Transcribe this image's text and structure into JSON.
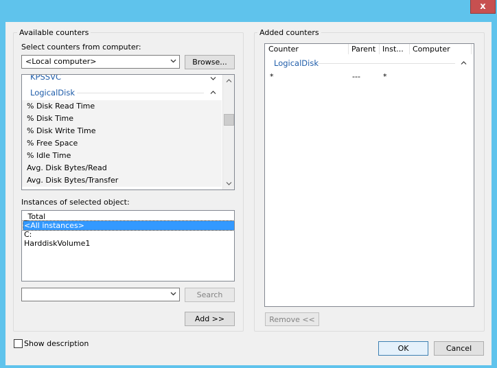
{
  "window": {
    "close_glyph": "x"
  },
  "available": {
    "legend": "Available counters",
    "computer_label": "Select counters from computer:",
    "computer_value": "<Local computer>",
    "browse_label": "Browse...",
    "objects_partial": "KPSSVC",
    "group_header": "LogicalDisk",
    "counters": [
      "% Disk Read Time",
      "% Disk Time",
      "% Disk Write Time",
      "% Free Space",
      "% Idle Time",
      "Avg. Disk Bytes/Read",
      "Avg. Disk Bytes/Transfer"
    ],
    "instances_label": "Instances of selected object:",
    "instances": [
      "_Total",
      "<All instances>",
      "C:",
      "HarddiskVolume1"
    ],
    "selected_instance": "<All instances>",
    "search_value": "",
    "search_label": "Search",
    "add_label": "Add >>"
  },
  "added": {
    "legend": "Added counters",
    "columns": [
      "Counter",
      "Parent",
      "Inst...",
      "Computer"
    ],
    "group_header": "LogicalDisk",
    "rows": [
      {
        "counter": "*",
        "parent": "---",
        "instance": "*",
        "computer": ""
      }
    ],
    "remove_label": "Remove <<"
  },
  "footer": {
    "show_description_label": "Show description",
    "show_description_checked": false,
    "ok_label": "OK",
    "cancel_label": "Cancel"
  },
  "icons": [
    "close-icon",
    "chevron-down-icon",
    "chevron-up-icon",
    "collapse-icon"
  ],
  "colors": {
    "titlebar": "#5fc3ec",
    "close": "#c75050",
    "selection": "#3399ff",
    "group_header": "#1e5ca9"
  }
}
